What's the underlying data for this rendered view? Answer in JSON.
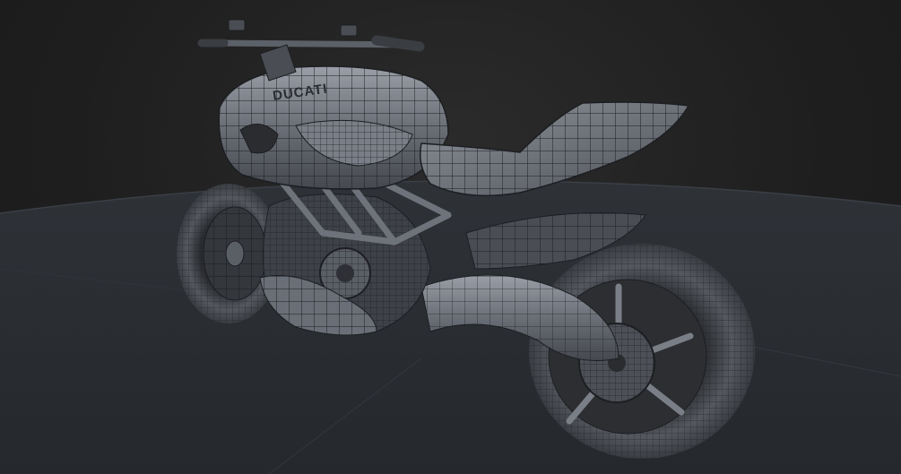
{
  "scene": {
    "subject": "motorcycle-wireframe-render",
    "brand_text": "DUCATI",
    "colors": {
      "background": "#1f1f1f",
      "floor": "#2a2e33",
      "body": "#5c6068",
      "body_light": "#8a8f98",
      "wire": "#1c1e22",
      "tire": "#3a3d42"
    }
  }
}
